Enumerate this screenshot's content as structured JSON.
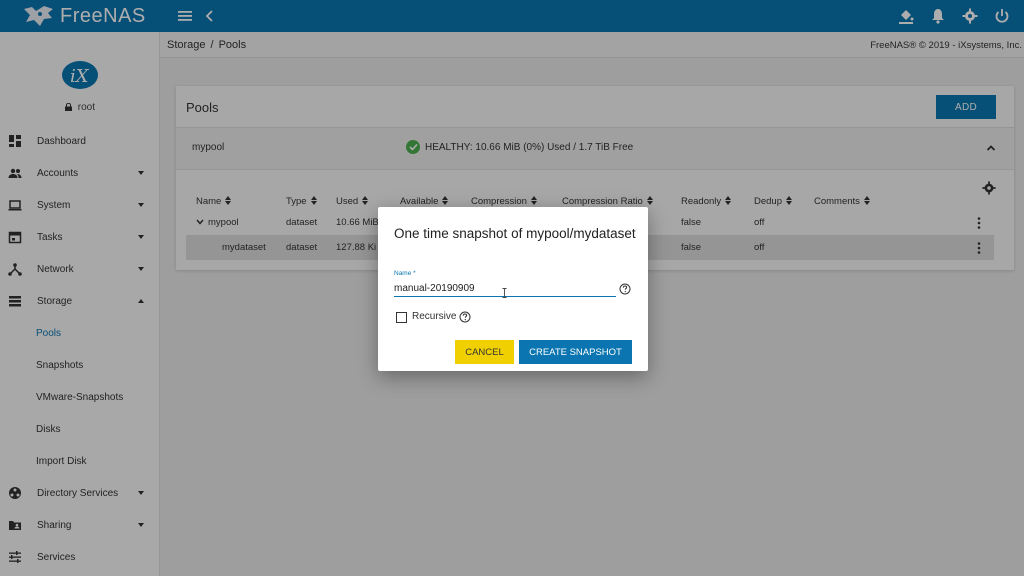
{
  "app": {
    "name": "FreeNAS",
    "brand_color": "#0a75b0"
  },
  "header": {
    "icons": [
      "menu-icon",
      "back-icon",
      "theme-icon",
      "bell-icon",
      "gear-icon",
      "power-icon"
    ]
  },
  "sidebar": {
    "user": "root",
    "items": [
      {
        "label": "Dashboard",
        "icon": "dashboard-icon"
      },
      {
        "label": "Accounts",
        "icon": "accounts-icon",
        "expandable": true
      },
      {
        "label": "System",
        "icon": "system-icon",
        "expandable": true
      },
      {
        "label": "Tasks",
        "icon": "tasks-icon",
        "expandable": true
      },
      {
        "label": "Network",
        "icon": "network-icon",
        "expandable": true
      },
      {
        "label": "Storage",
        "icon": "storage-icon",
        "expandable": true,
        "expanded": true
      },
      {
        "label": "Directory Services",
        "icon": "directory-icon",
        "expandable": true
      },
      {
        "label": "Sharing",
        "icon": "sharing-icon",
        "expandable": true
      },
      {
        "label": "Services",
        "icon": "services-icon"
      }
    ],
    "storage_sub": [
      "Pools",
      "Snapshots",
      "VMware-Snapshots",
      "Disks",
      "Import Disk"
    ]
  },
  "breadcrumb": {
    "parent": "Storage",
    "sep": "/",
    "current": "Pools"
  },
  "copyright": "FreeNAS® © 2019 - iXsystems, Inc.",
  "pools": {
    "title": "Pools",
    "add_label": "ADD",
    "pool_name": "mypool",
    "health": "HEALTHY: 10.66 MiB (0%) Used / 1.7 TiB Free",
    "columns": [
      "Name",
      "Type",
      "Used",
      "Available",
      "Compression",
      "Compression Ratio",
      "Readonly",
      "Dedup",
      "Comments"
    ],
    "rows": [
      {
        "name": "mypool",
        "type": "dataset",
        "used": "10.66 MiB",
        "readonly": "false",
        "dedup": "off"
      },
      {
        "name": "mydataset",
        "type": "dataset",
        "used": "127.88 Ki",
        "readonly": "false",
        "dedup": "off"
      }
    ]
  },
  "dialog": {
    "title": "One time snapshot of mypool/mydataset",
    "name_label": "Name",
    "required_mark": "*",
    "name_value": "manual-20190909",
    "recursive_label": "Recursive",
    "recursive_checked": false,
    "cancel_label": "CANCEL",
    "create_label": "CREATE SNAPSHOT"
  }
}
